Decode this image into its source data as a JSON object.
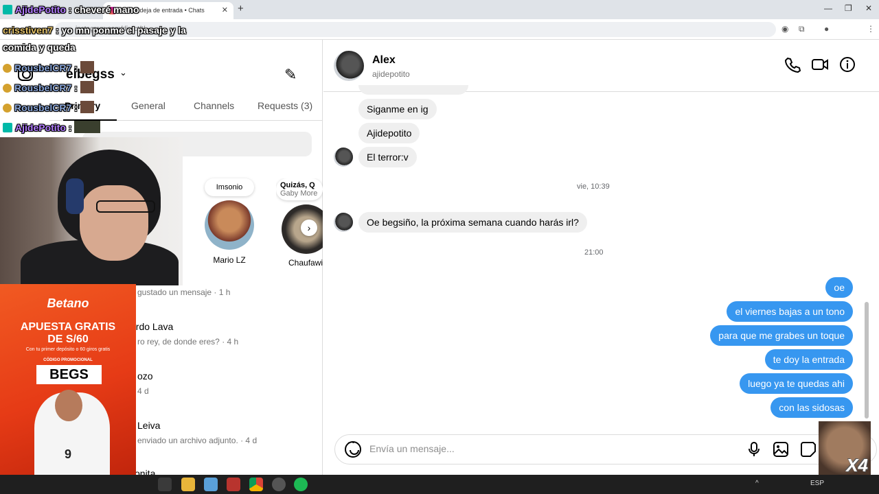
{
  "browser": {
    "tab_title": "(9) Bandeja de entrada • Chats",
    "tab_close": "✕",
    "new_tab": "+",
    "url": "instagram.com/direct/t/..."
  },
  "inbox": {
    "username": "elbegss",
    "filters": [
      "Primary",
      "General",
      "Channels",
      "Requests (3)"
    ],
    "notes": [
      {
        "bubble": "Imsonio",
        "name": "Mario LZ"
      },
      {
        "bubble": "Quizás, Q",
        "sub": "Gaby More",
        "name": "Chaufawi"
      }
    ],
    "rows": [
      {
        "sub": "gustado un mensaje · 1 h"
      },
      {
        "name": "ardo Lava",
        "sub": "ro rey, de donde eres? · 4 h"
      },
      {
        "name": "ozo",
        "sub": "4 d"
      },
      {
        "name": "Leiva",
        "sub": "enviado un archivo adjunto. · 4 d"
      },
      {
        "name": "onita"
      }
    ]
  },
  "conversation": {
    "name": "Alex",
    "handle": "ajidepotito",
    "incoming": [
      "Siganme en ig",
      "Ajidepotito",
      "El terror:v"
    ],
    "stamp1": "vie, 10:39",
    "incoming2": "Oe begsiño, la próxima semana cuando harás irl?",
    "stamp2": "21:00",
    "outgoing": [
      "oe",
      "el viernes bajas a un tono",
      "para que me grabes un toque",
      "te doy la entrada",
      "luego ya te quedas ahi",
      "con las sidosas"
    ],
    "composer_placeholder": "Envía un mensaje..."
  },
  "stream_chat": [
    {
      "user": "AjidePotito",
      "text": ": cheveré mano"
    },
    {
      "user": "crisstiven7",
      "text": ": yo mn ponme el pasaje y la"
    },
    {
      "user": "",
      "text": "comida y queda"
    },
    {
      "user": "RousbelCR7",
      "text": ""
    },
    {
      "user": "RousbelCR7",
      "text": ""
    },
    {
      "user": "RousbelCR7",
      "text": ""
    },
    {
      "user": "AjidePotito",
      "text": ""
    }
  ],
  "ad": {
    "brand": "Betano",
    "headline1": "APUESTA GRATIS",
    "headline2": "DE S/60",
    "small": "Con tu primer depósito o 60 giros gratis",
    "code_label": "CÓDIGO PROMOCIONAL",
    "code": "BEGS",
    "jersey_number": "9"
  },
  "meme": {
    "multiplier": "X4"
  },
  "taskbar": {
    "language": "ESP"
  },
  "colors": {
    "accent": "#3797f0",
    "incoming_bg": "#efefef",
    "ad": "#e63b16"
  }
}
